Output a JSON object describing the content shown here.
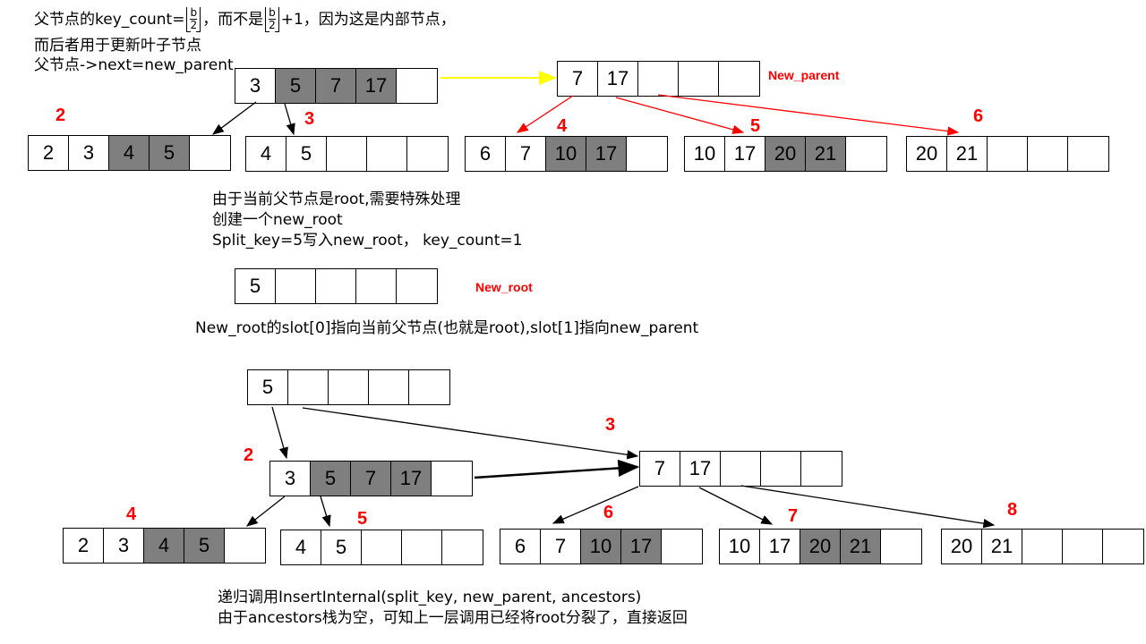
{
  "top_text": {
    "line1_prefix": "父节点的key_count=",
    "frac_num": "b",
    "frac_den": "2",
    "line1_mid": "，而不是",
    "frac2_num": "b",
    "frac2_den": "2",
    "line1_suffix": "+1，因为这是内部节点，",
    "line2": "而后者用于更新叶子节点",
    "line3": "父节点->next=new_parent"
  },
  "middle_text": {
    "line1": "由于当前父节点是root,需要特殊处理",
    "line2": "创建一个new_root",
    "line3": "Split_key=5写入new_root， key_count=1",
    "line4": "New_root的slot[0]指向当前父节点(也就是root),slot[1]指向new_parent"
  },
  "bottom_text": {
    "line1": "递归调用InsertInternal(split_key, new_parent, ancestors)",
    "line2": "由于ancestors栈为空，可知上一层调用已经将root分裂了，直接返回"
  },
  "tags": {
    "new_parent": "New_parent",
    "new_root": "New_root"
  },
  "labels": {
    "top_l2": "2",
    "top_l3": "3",
    "top_l4": "4",
    "top_l5": "5",
    "top_l6": "6",
    "bot_l2": "2",
    "bot_l3": "3",
    "bot_l4": "4",
    "bot_l5": "5",
    "bot_l6": "6",
    "bot_l7": "7",
    "bot_l8": "8"
  },
  "nodes": {
    "top_parent": [
      "3",
      "5",
      "7",
      "17",
      ""
    ],
    "top_new_parent": [
      "7",
      "17",
      "",
      "",
      ""
    ],
    "top_leaf2": [
      "2",
      "3",
      "4",
      "5",
      ""
    ],
    "top_leaf3": [
      "4",
      "5",
      "",
      "",
      ""
    ],
    "top_leaf4": [
      "6",
      "7",
      "10",
      "17",
      ""
    ],
    "top_leaf5": [
      "10",
      "17",
      "20",
      "21",
      ""
    ],
    "top_leaf6": [
      "20",
      "21",
      "",
      "",
      ""
    ],
    "new_root": [
      "5",
      "",
      "",
      "",
      ""
    ],
    "bot_root": [
      "5",
      "",
      "",
      "",
      ""
    ],
    "bot_parent": [
      "3",
      "5",
      "7",
      "17",
      ""
    ],
    "bot_new_parent": [
      "7",
      "17",
      "",
      "",
      ""
    ],
    "bot_leaf4": [
      "2",
      "3",
      "4",
      "5",
      ""
    ],
    "bot_leaf5": [
      "4",
      "5",
      "",
      "",
      ""
    ],
    "bot_leaf6": [
      "6",
      "7",
      "10",
      "17",
      ""
    ],
    "bot_leaf7": [
      "10",
      "17",
      "20",
      "21",
      ""
    ],
    "bot_leaf8": [
      "20",
      "21",
      "",
      "",
      ""
    ]
  },
  "shaded_slots": {
    "top_parent": [
      1,
      2,
      3
    ],
    "top_leaf2": [
      2,
      3
    ],
    "top_leaf4": [
      2,
      3
    ],
    "top_leaf5": [
      2,
      3
    ],
    "bot_parent": [
      1,
      2,
      3
    ],
    "bot_leaf4": [
      2,
      3
    ],
    "bot_leaf6": [
      2,
      3
    ],
    "bot_leaf7": [
      2,
      3
    ]
  },
  "colors": {
    "shaded": "#7f7f7f",
    "red": "#ff0000",
    "yellow_arrow": "#ffff00"
  }
}
